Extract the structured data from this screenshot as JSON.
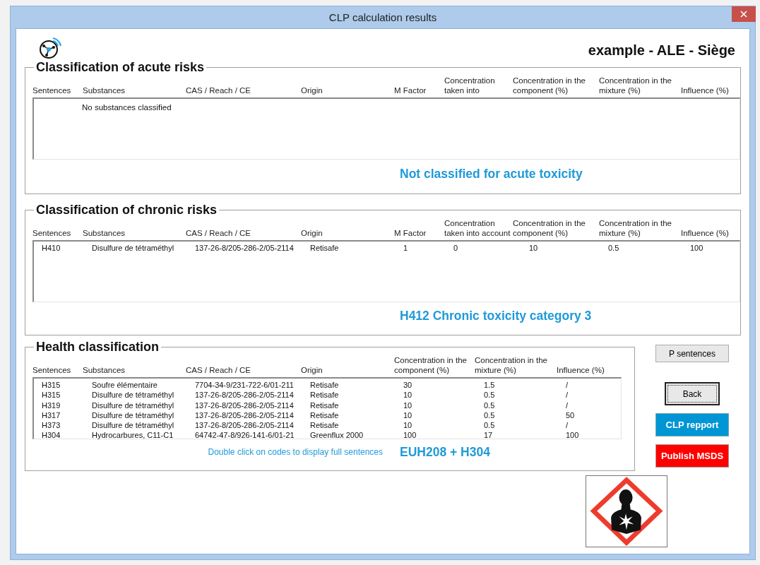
{
  "window": {
    "title": "CLP calculation results"
  },
  "company": "example - ALE - Siège",
  "acute_risks": {
    "title": "Classification of acute risks",
    "columns": [
      "Sentences",
      "Substances",
      "CAS / Reach / CE",
      "Origin",
      "M Factor",
      "Concentration taken into",
      "Concentration in the component (%)",
      "Concentration in the mixture (%)",
      "Influence (%)"
    ],
    "empty_message": "No substances classified",
    "result": "Not classified for acute toxicity"
  },
  "chronic_risks": {
    "title": "Classification of chronic risks",
    "columns": [
      "Sentences",
      "Substances",
      "CAS / Reach / CE",
      "Origin",
      "M Factor",
      "Concentration taken into account",
      "Concentration in the component (%)",
      "Concentration in the mixture (%)",
      "Influence (%)"
    ],
    "rows": [
      [
        "H410",
        "Disulfure de tétraméthyl",
        "137-26-8/205-286-2/05-2114",
        "Retisafe",
        "1",
        "0",
        "10",
        "0.5",
        "100"
      ]
    ],
    "result": "H412 Chronic toxicity category 3"
  },
  "health_classification": {
    "title": "Health classification",
    "columns": [
      "Sentences",
      "Substances",
      "CAS / Reach / CE",
      "Origin",
      "Concentration in the component (%)",
      "Concentration in the mixture (%)",
      "Influence (%)"
    ],
    "rows": [
      [
        "H315",
        "Soufre élémentaire",
        "7704-34-9/231-722-6/01-211",
        "Retisafe",
        "30",
        "1.5",
        "/"
      ],
      [
        "H315",
        "Disulfure de tétraméthyl",
        "137-26-8/205-286-2/05-2114",
        "Retisafe",
        "10",
        "0.5",
        "/"
      ],
      [
        "H319",
        "Disulfure de tétraméthyl",
        "137-26-8/205-286-2/05-2114",
        "Retisafe",
        "10",
        "0.5",
        "/"
      ],
      [
        "H317",
        "Disulfure de tétraméthyl",
        "137-26-8/205-286-2/05-2114",
        "Retisafe",
        "10",
        "0.5",
        "50"
      ],
      [
        "H373",
        "Disulfure de tétraméthyl",
        "137-26-8/205-286-2/05-2114",
        "Retisafe",
        "10",
        "0.5",
        "/"
      ],
      [
        "H304",
        "Hydrocarbures, C11-C1",
        "64742-47-8/926-141-6/01-21",
        "Greenflux 2000",
        "100",
        "17",
        "100"
      ]
    ],
    "hint": "Double click on codes to display full sentences",
    "result": "EUH208 + H304"
  },
  "buttons": [
    {
      "label": "P sentences",
      "kind": "plain"
    },
    {
      "label": "Back",
      "kind": "default"
    },
    {
      "label": "CLP repport",
      "kind": "primary"
    },
    {
      "label": "Publish MSDS",
      "kind": "danger"
    }
  ]
}
